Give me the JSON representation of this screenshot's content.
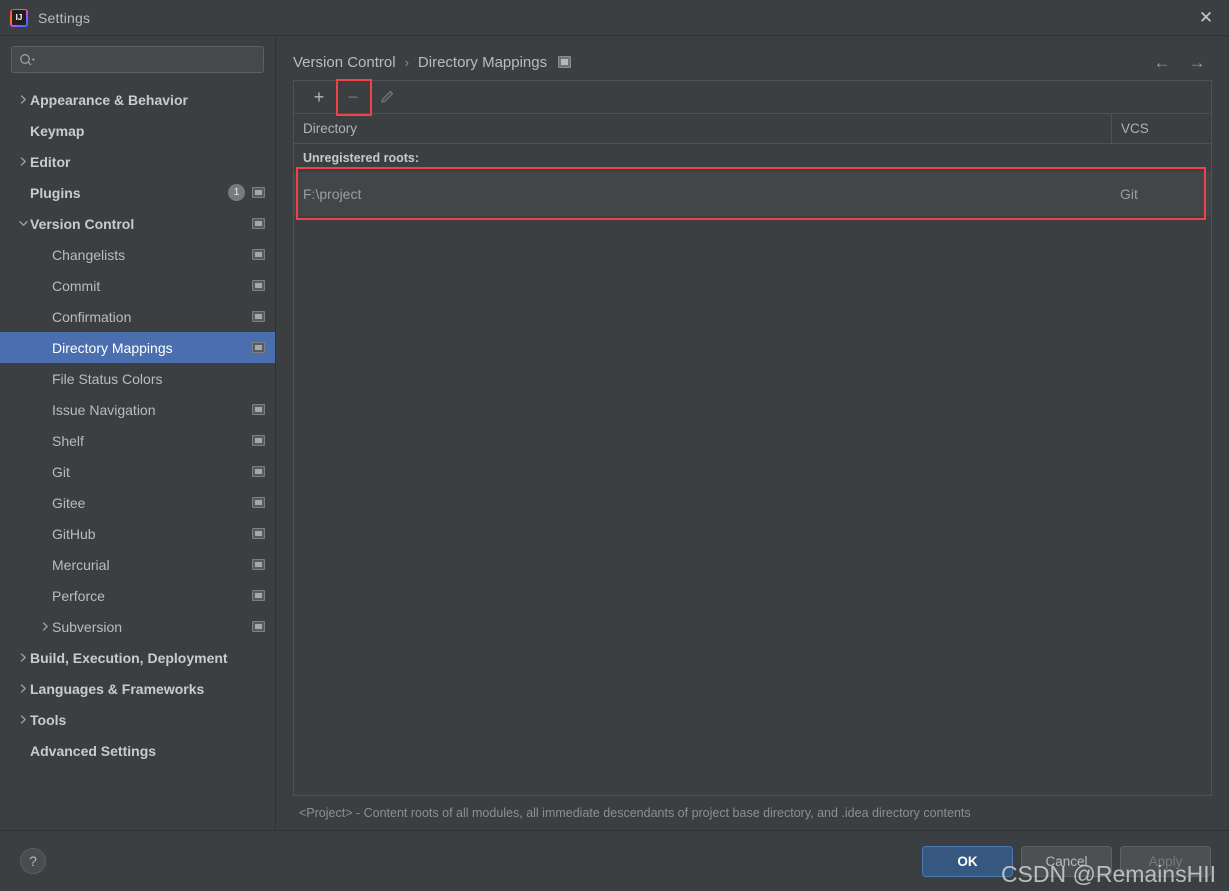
{
  "window": {
    "title": "Settings",
    "logo_text": "IJ",
    "close_icon": "✕"
  },
  "search": {
    "value": "",
    "placeholder": "",
    "icon": "search-icon"
  },
  "sidebar": {
    "items": [
      {
        "label": "Appearance & Behavior",
        "indent": 0,
        "group": true,
        "twisty": "right",
        "badge": "",
        "cfg": false,
        "selected": false
      },
      {
        "label": "Keymap",
        "indent": 0,
        "group": true,
        "twisty": "none",
        "badge": "",
        "cfg": false,
        "selected": false
      },
      {
        "label": "Editor",
        "indent": 0,
        "group": true,
        "twisty": "right",
        "badge": "",
        "cfg": false,
        "selected": false
      },
      {
        "label": "Plugins",
        "indent": 0,
        "group": true,
        "twisty": "none",
        "badge": "1",
        "cfg": true,
        "selected": false
      },
      {
        "label": "Version Control",
        "indent": 0,
        "group": true,
        "twisty": "down",
        "badge": "",
        "cfg": true,
        "selected": false
      },
      {
        "label": "Changelists",
        "indent": 1,
        "group": false,
        "twisty": "none",
        "badge": "",
        "cfg": true,
        "selected": false
      },
      {
        "label": "Commit",
        "indent": 1,
        "group": false,
        "twisty": "none",
        "badge": "",
        "cfg": true,
        "selected": false
      },
      {
        "label": "Confirmation",
        "indent": 1,
        "group": false,
        "twisty": "none",
        "badge": "",
        "cfg": true,
        "selected": false
      },
      {
        "label": "Directory Mappings",
        "indent": 1,
        "group": false,
        "twisty": "none",
        "badge": "",
        "cfg": true,
        "selected": true
      },
      {
        "label": "File Status Colors",
        "indent": 1,
        "group": false,
        "twisty": "none",
        "badge": "",
        "cfg": false,
        "selected": false
      },
      {
        "label": "Issue Navigation",
        "indent": 1,
        "group": false,
        "twisty": "none",
        "badge": "",
        "cfg": true,
        "selected": false
      },
      {
        "label": "Shelf",
        "indent": 1,
        "group": false,
        "twisty": "none",
        "badge": "",
        "cfg": true,
        "selected": false
      },
      {
        "label": "Git",
        "indent": 1,
        "group": false,
        "twisty": "none",
        "badge": "",
        "cfg": true,
        "selected": false
      },
      {
        "label": "Gitee",
        "indent": 1,
        "group": false,
        "twisty": "none",
        "badge": "",
        "cfg": true,
        "selected": false
      },
      {
        "label": "GitHub",
        "indent": 1,
        "group": false,
        "twisty": "none",
        "badge": "",
        "cfg": true,
        "selected": false
      },
      {
        "label": "Mercurial",
        "indent": 1,
        "group": false,
        "twisty": "none",
        "badge": "",
        "cfg": true,
        "selected": false
      },
      {
        "label": "Perforce",
        "indent": 1,
        "group": false,
        "twisty": "none",
        "badge": "",
        "cfg": true,
        "selected": false
      },
      {
        "label": "Subversion",
        "indent": 1,
        "group": false,
        "twisty": "right",
        "badge": "",
        "cfg": true,
        "selected": false
      },
      {
        "label": "Build, Execution, Deployment",
        "indent": 0,
        "group": true,
        "twisty": "right",
        "badge": "",
        "cfg": false,
        "selected": false
      },
      {
        "label": "Languages & Frameworks",
        "indent": 0,
        "group": true,
        "twisty": "right",
        "badge": "",
        "cfg": false,
        "selected": false
      },
      {
        "label": "Tools",
        "indent": 0,
        "group": true,
        "twisty": "right",
        "badge": "",
        "cfg": false,
        "selected": false
      },
      {
        "label": "Advanced Settings",
        "indent": 0,
        "group": true,
        "twisty": "none",
        "badge": "",
        "cfg": false,
        "selected": false
      }
    ]
  },
  "breadcrumb": {
    "parent": "Version Control",
    "separator": "›",
    "current": "Directory Mappings",
    "project_icon": "project-settings-icon",
    "back_arrow": "←",
    "forward_arrow": "→"
  },
  "toolbar": {
    "add_label": "+",
    "remove_label": "−",
    "edit_label": "✎",
    "remove_highlighted": true
  },
  "table": {
    "columns": [
      "Directory",
      "VCS"
    ],
    "groups": [
      {
        "title": "Unregistered roots:",
        "rows": [
          {
            "directory": "F:\\project",
            "vcs": "Git",
            "highlighted": true
          }
        ]
      }
    ]
  },
  "hint": "<Project> - Content roots of all modules, all immediate descendants of project base directory, and .idea directory contents",
  "footer": {
    "help_label": "?",
    "ok_label": "OK",
    "cancel_label": "Cancel",
    "apply_label": "Apply"
  },
  "watermark": "CSDN @RemainsHII",
  "colors": {
    "background": "#3c3f41",
    "selection": "#4b6eaf",
    "accent_primary": "#365880",
    "highlight_red": "#f5404a",
    "text": "#bbbbbb"
  }
}
